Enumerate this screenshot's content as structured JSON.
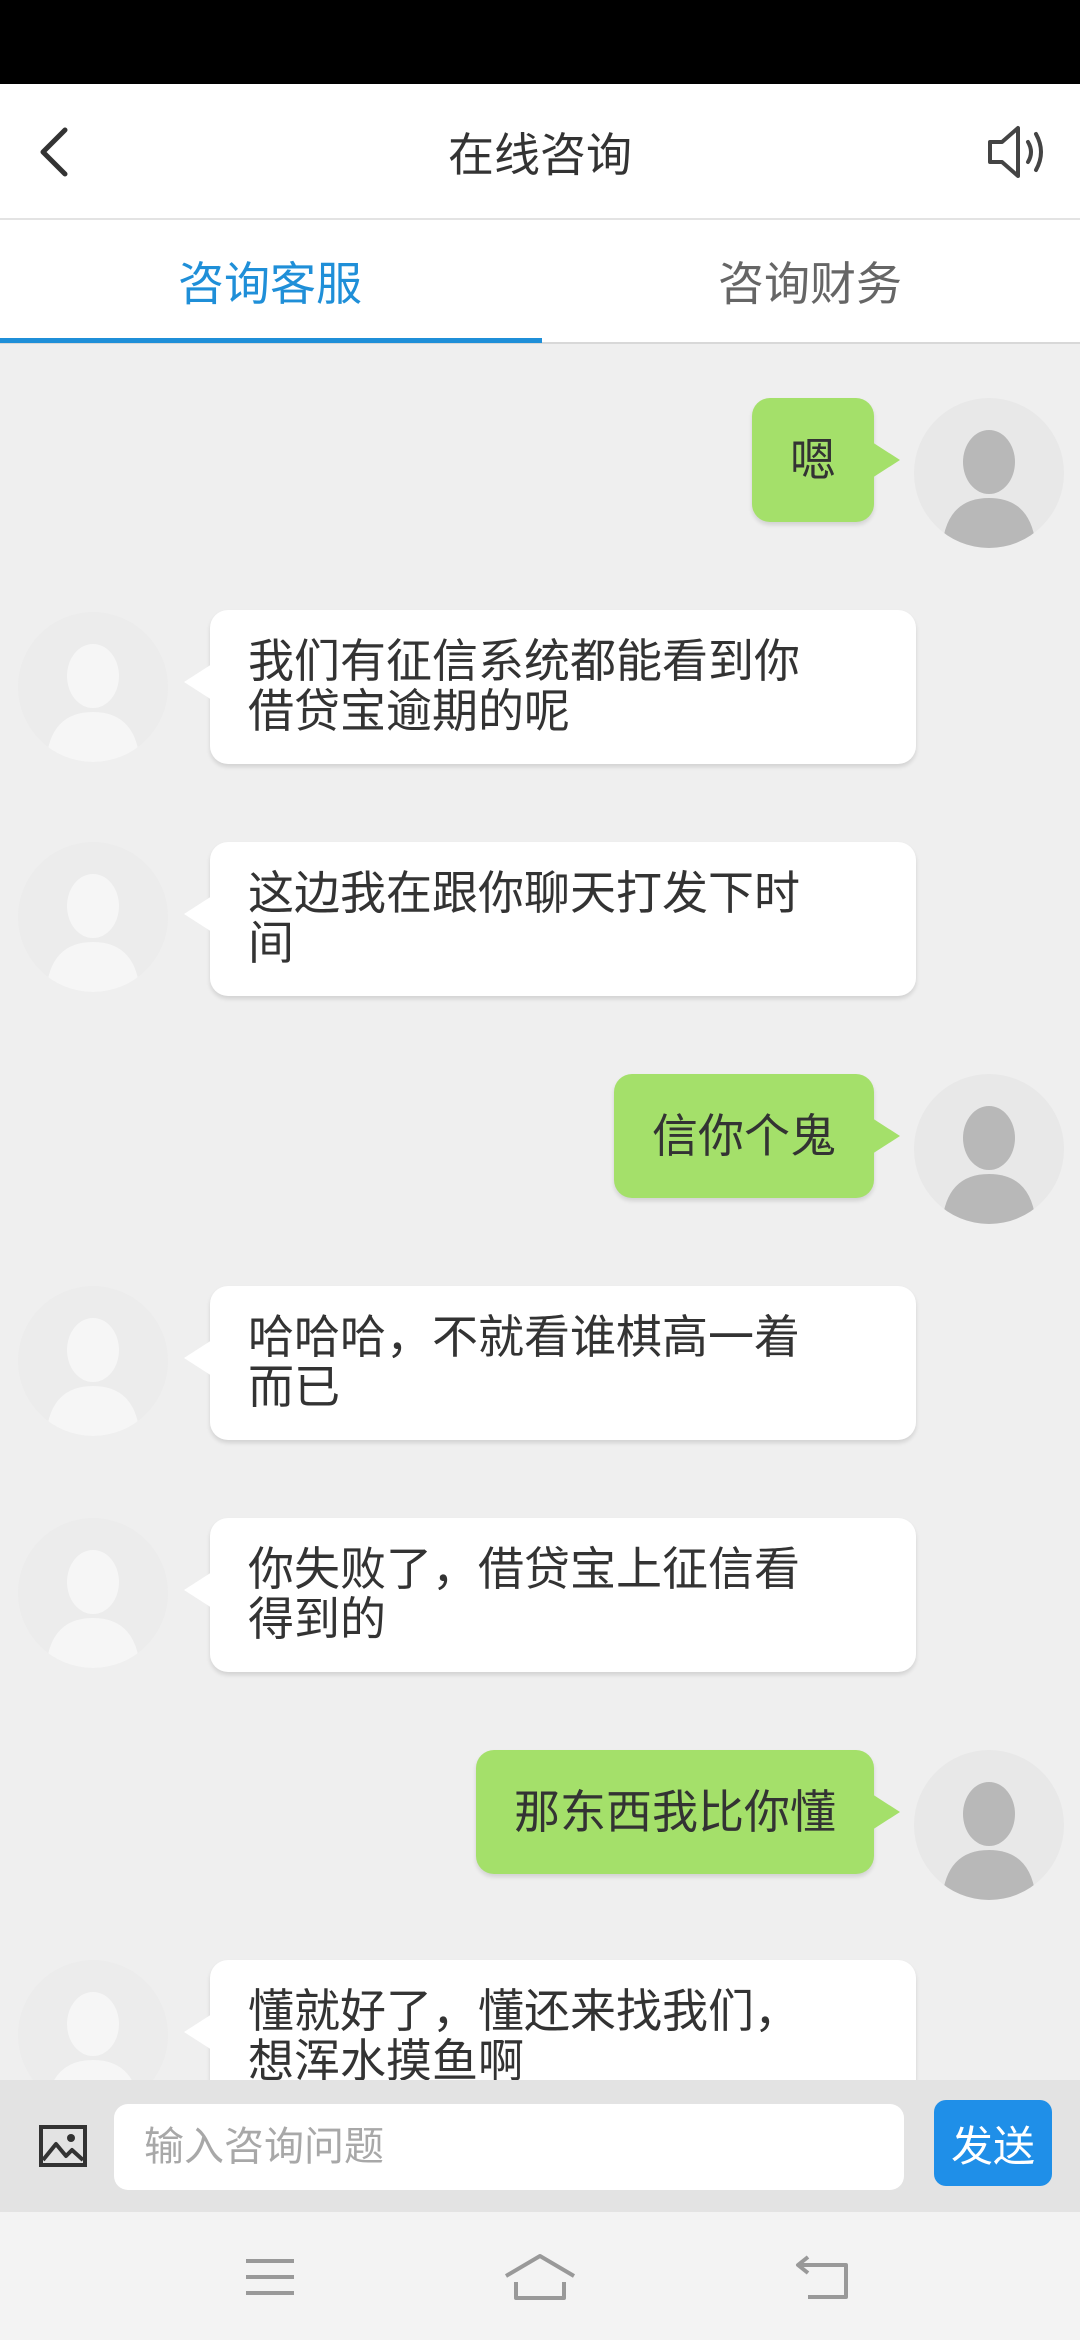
{
  "header": {
    "title": "在线咨询"
  },
  "tabs": [
    {
      "label": "咨询客服",
      "active": true
    },
    {
      "label": "咨询财务",
      "active": false
    }
  ],
  "messages": [
    {
      "side": "right",
      "text": "嗯"
    },
    {
      "side": "left",
      "lines": [
        "我们有征信系统都能看到你",
        "借贷宝逾期的呢"
      ]
    },
    {
      "side": "left",
      "lines": [
        "这边我在跟你聊天打发下时",
        "间"
      ]
    },
    {
      "side": "right",
      "text": "信你个鬼"
    },
    {
      "side": "left",
      "lines": [
        "哈哈哈，不就看谁棋高一着",
        "而已"
      ]
    },
    {
      "side": "left",
      "lines": [
        "你失败了，借贷宝上征信看",
        "得到的"
      ]
    },
    {
      "side": "right",
      "text": "那东西我比你懂"
    },
    {
      "side": "left",
      "lines": [
        "懂就好了，懂还来找我们，",
        "想浑水摸鱼啊"
      ]
    }
  ],
  "input": {
    "placeholder": "输入咨询问题",
    "value": ""
  },
  "send_label": "发送",
  "colors": {
    "accent": "#1f8fd8",
    "outgoing_bubble": "#a4e06a",
    "incoming_bubble": "#ffffff",
    "send_button": "#1f8fe8"
  },
  "icons": {
    "back": "chevron-left-icon",
    "speaker": "speaker-icon",
    "image": "image-icon",
    "avatar": "user-silhouette-icon",
    "nav": [
      "menu-icon",
      "home-icon",
      "back-arrow-icon"
    ]
  }
}
